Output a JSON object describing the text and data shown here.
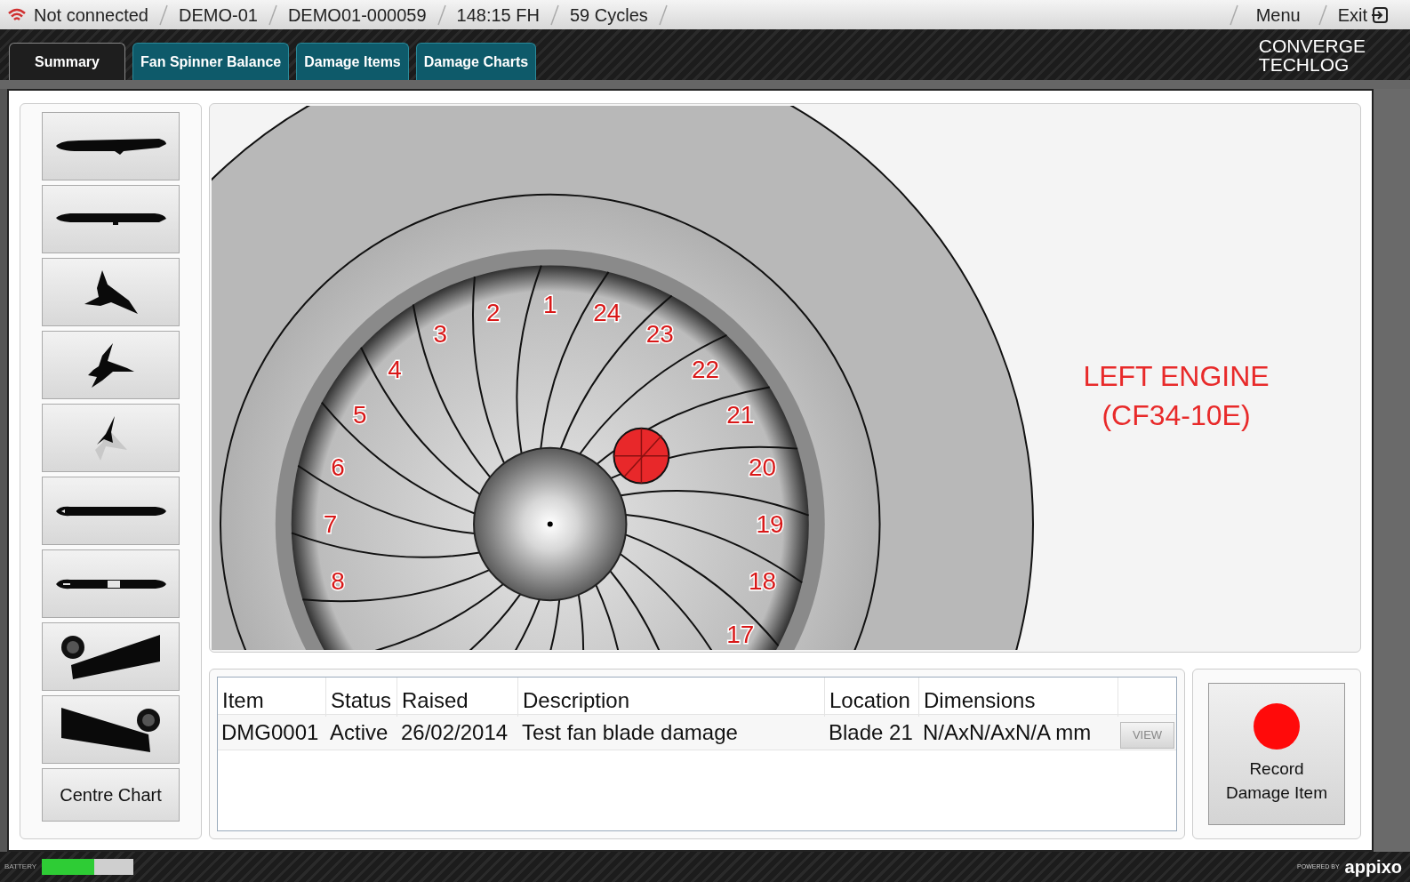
{
  "status_bar": {
    "connection": "Not connected",
    "items": [
      "DEMO-01",
      "DEMO01-000059",
      "148:15 FH",
      "59 Cycles"
    ],
    "menu": "Menu",
    "exit": "Exit"
  },
  "tabs": [
    {
      "label": "Summary",
      "selected": true
    },
    {
      "label": "Fan Spinner Balance",
      "selected": false
    },
    {
      "label": "Damage Items",
      "selected": false
    },
    {
      "label": "Damage Charts",
      "selected": false
    }
  ],
  "logo": [
    "CONVERGE",
    "TECHLOG"
  ],
  "views": [
    {
      "kind": "side"
    },
    {
      "kind": "side-flat"
    },
    {
      "kind": "angled"
    },
    {
      "kind": "angled-low"
    },
    {
      "kind": "angled-faded"
    },
    {
      "kind": "fuselage"
    },
    {
      "kind": "fuselage-door"
    },
    {
      "kind": "wing-left"
    },
    {
      "kind": "wing-right"
    }
  ],
  "centre_button": "Centre Chart",
  "engine": {
    "title": "LEFT ENGINE",
    "model": "(CF34-10E)",
    "blade_labels": [
      "2",
      "1",
      "24",
      "3",
      "23",
      "4",
      "22",
      "5",
      "21",
      "6",
      "20",
      "7",
      "19",
      "8",
      "18",
      "17"
    ]
  },
  "table": {
    "columns": [
      "Item",
      "Status",
      "Raised",
      "Description",
      "Location",
      "Dimensions"
    ],
    "rows": [
      {
        "cells": [
          "DMG0001",
          "Active",
          "26/02/2014",
          "Test fan blade damage",
          "Blade 21",
          "N/AxN/AxN/A mm"
        ],
        "action": "VIEW"
      }
    ]
  },
  "record_button": [
    "Record",
    "Damage Item"
  ],
  "footer": {
    "battery_label": "BATTERY",
    "battery": {
      "level": 0.57
    },
    "powered_by": "POWERED BY",
    "brand": "appixo"
  }
}
